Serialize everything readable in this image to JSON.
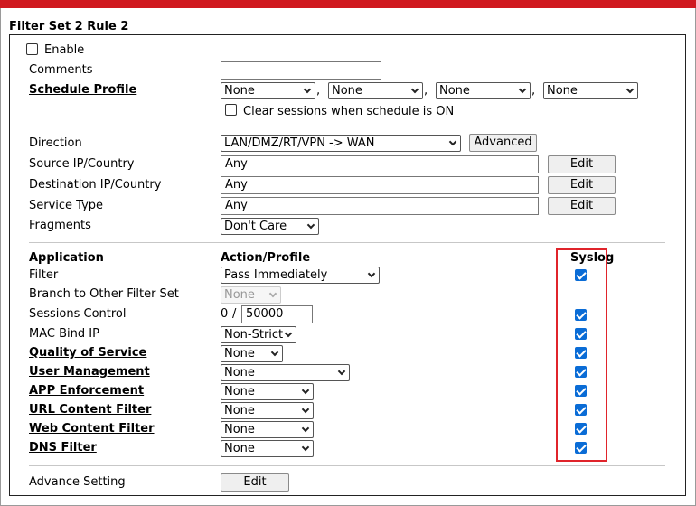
{
  "title": "Filter Set 2 Rule 2",
  "enable": {
    "label": "Enable",
    "checked": false
  },
  "comments": {
    "label": "Comments",
    "value": ""
  },
  "schedule": {
    "label": "Schedule Profile",
    "options": [
      "None",
      "None",
      "None",
      "None"
    ],
    "clear_sessions": {
      "label": "Clear sessions when schedule is ON",
      "checked": false
    },
    "comma": ","
  },
  "direction": {
    "label": "Direction",
    "value": "LAN/DMZ/RT/VPN -> WAN",
    "advanced_label": "Advanced"
  },
  "source": {
    "label": "Source IP/Country",
    "value": "Any",
    "edit_label": "Edit"
  },
  "destination": {
    "label": "Destination IP/Country",
    "value": "Any",
    "edit_label": "Edit"
  },
  "service": {
    "label": "Service Type",
    "value": "Any",
    "edit_label": "Edit"
  },
  "fragments": {
    "label": "Fragments",
    "value": "Don't Care"
  },
  "app_headers": {
    "application": "Application",
    "action": "Action/Profile",
    "syslog": "Syslog"
  },
  "app_rows": [
    {
      "label": "Filter",
      "value": "Pass Immediately",
      "syslog": true
    },
    {
      "label": "Branch to Other Filter Set",
      "value": "None",
      "disabled": true
    },
    {
      "label": "Sessions Control",
      "prefix": "0",
      "slash": "/",
      "value": "50000",
      "syslog": true
    },
    {
      "label": "MAC Bind IP",
      "value": "Non-Strict",
      "syslog": true
    },
    {
      "label": "Quality of Service",
      "value": "None",
      "syslog": true
    },
    {
      "label": "User Management",
      "value": "None",
      "syslog": true
    },
    {
      "label": "APP Enforcement",
      "value": "None",
      "syslog": true
    },
    {
      "label": "URL Content Filter",
      "value": "None",
      "syslog": true
    },
    {
      "label": "Web Content Filter",
      "value": "None",
      "syslog": true
    },
    {
      "label": "DNS Filter",
      "value": "None",
      "syslog": true
    }
  ],
  "advance": {
    "label": "Advance Setting",
    "edit_label": "Edit"
  },
  "colors": {
    "top_bar": "#d0191f",
    "checkbox_checked": "#0a6cd6",
    "highlight_box": "#e0242b"
  }
}
